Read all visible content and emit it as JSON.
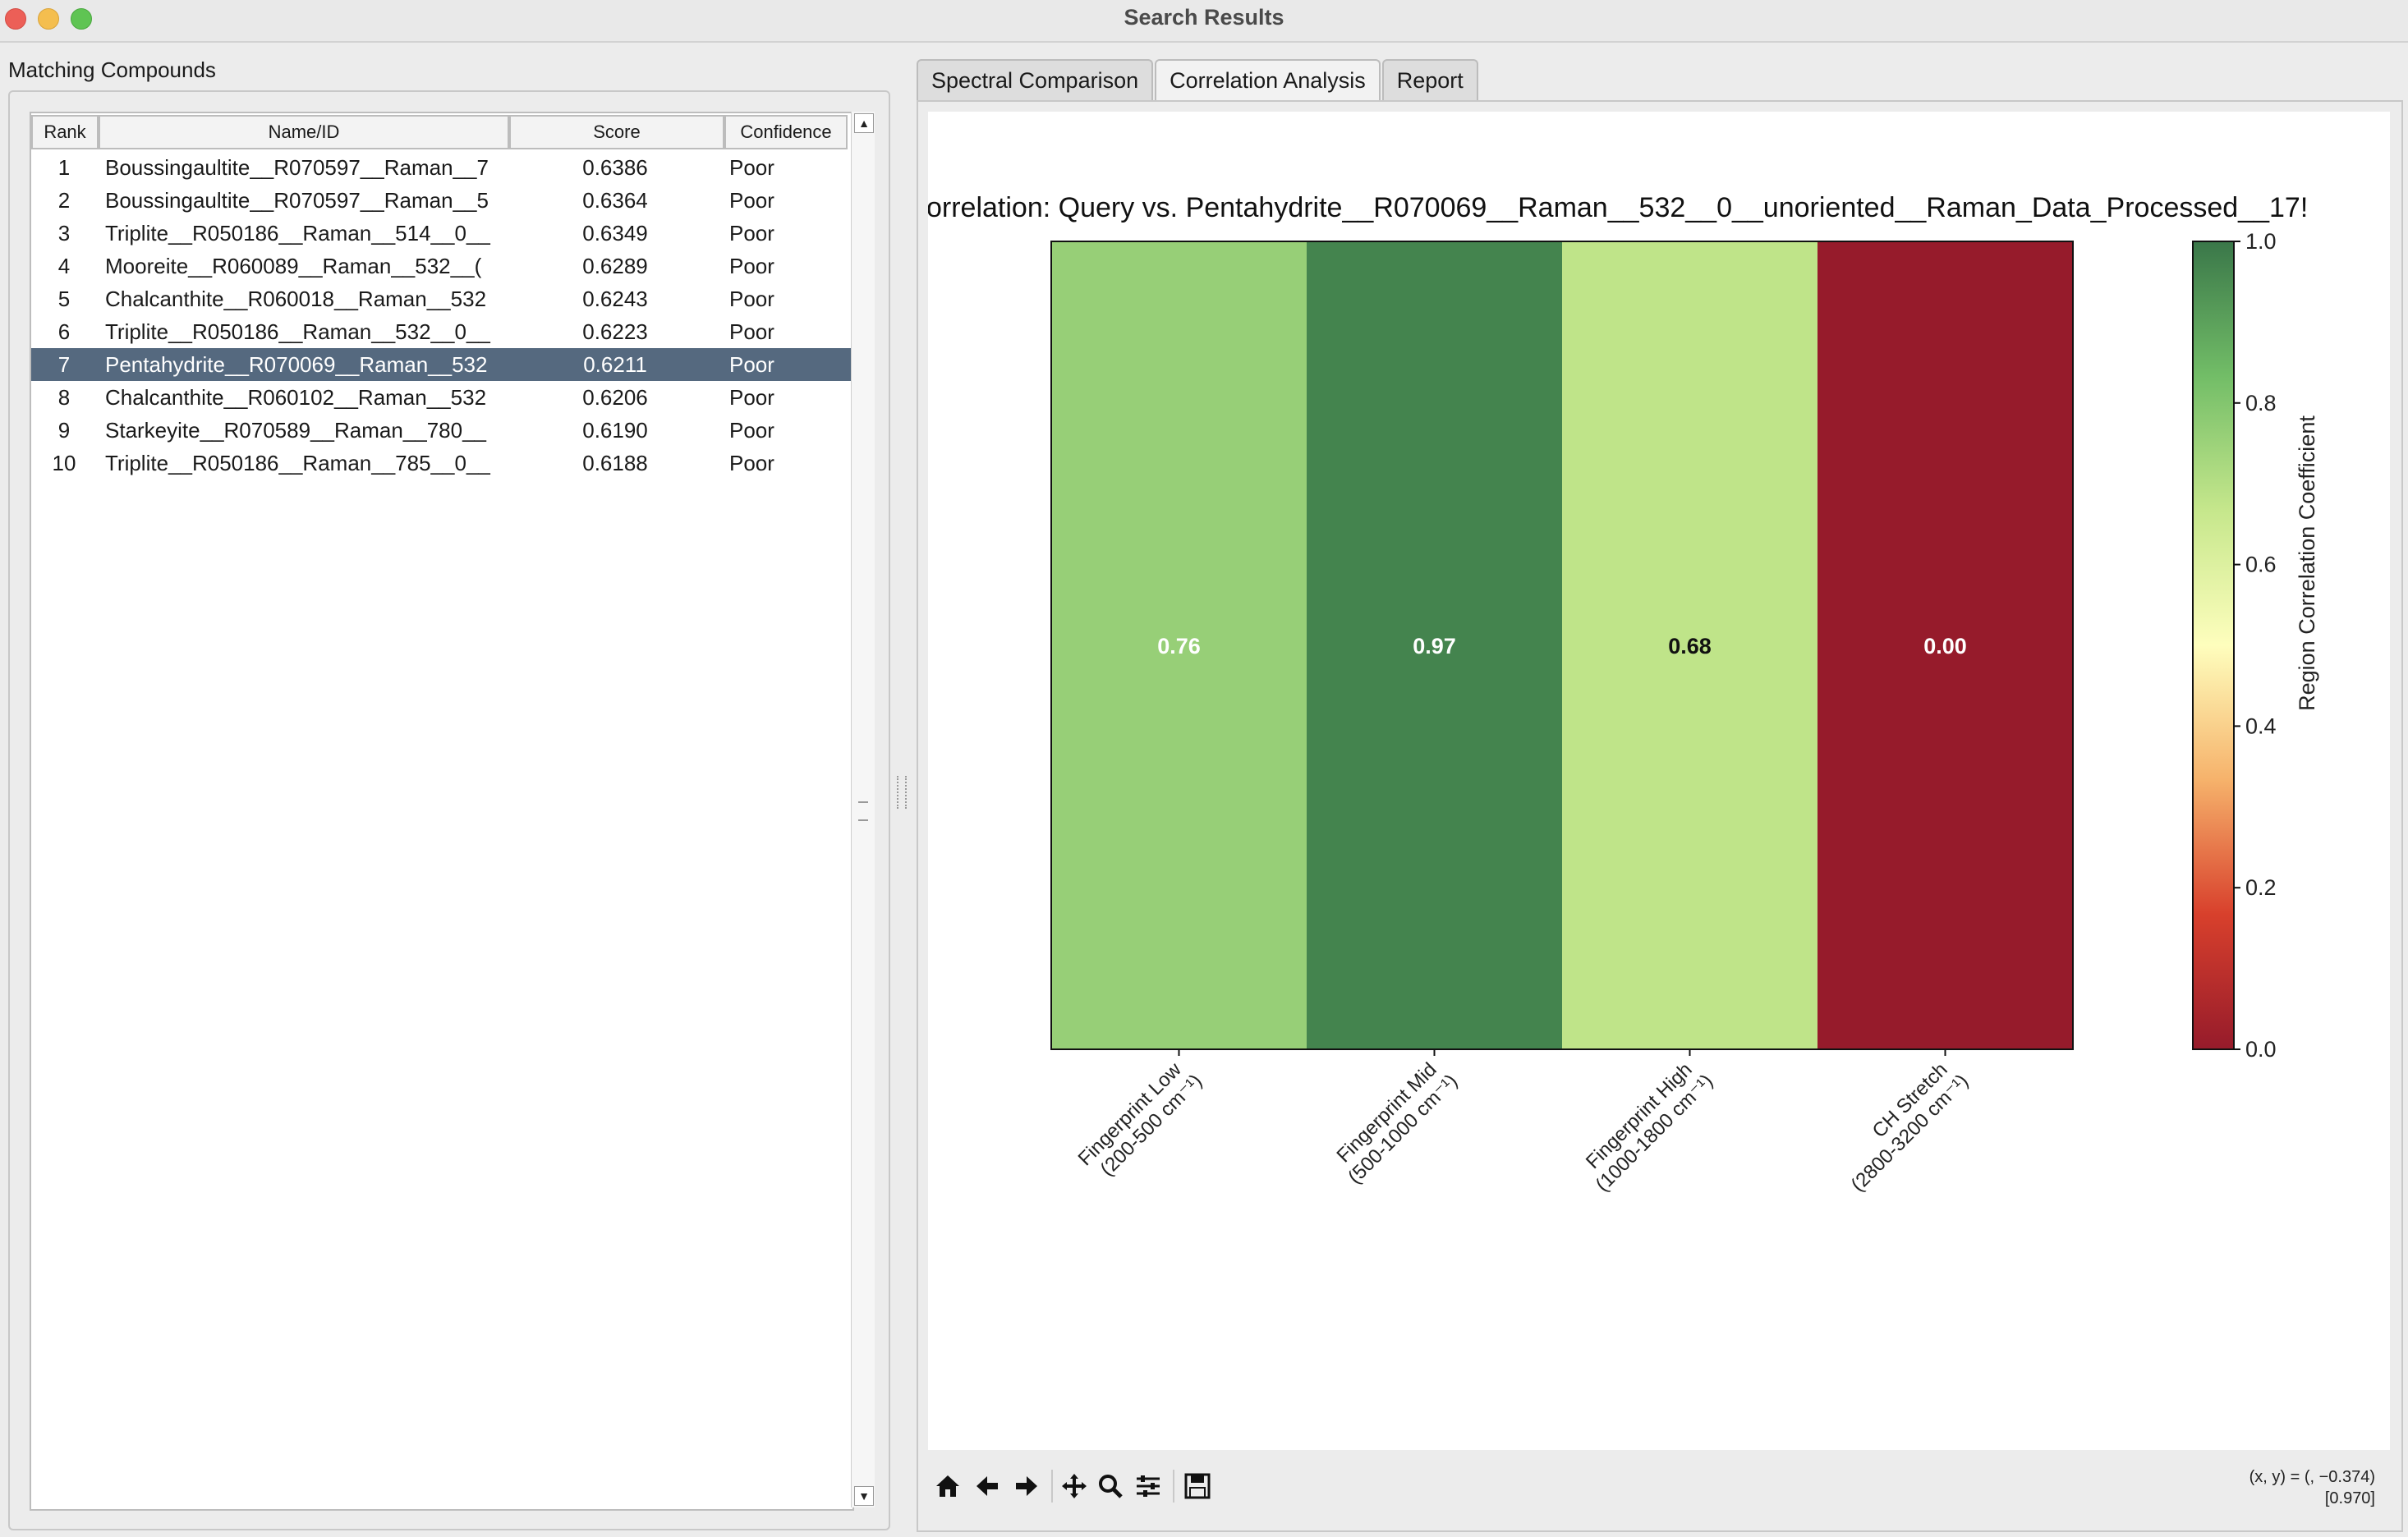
{
  "window": {
    "title": "Search Results"
  },
  "left_panel": {
    "label": "Matching Compounds",
    "columns": [
      "Rank",
      "Name/ID",
      "Score",
      "Confidence"
    ],
    "rows": [
      {
        "rank": "1",
        "name": "Boussingaultite__R070597__Raman__7",
        "score": "0.6386",
        "confidence": "Poor"
      },
      {
        "rank": "2",
        "name": "Boussingaultite__R070597__Raman__5",
        "score": "0.6364",
        "confidence": "Poor"
      },
      {
        "rank": "3",
        "name": "Triplite__R050186__Raman__514__0__",
        "score": "0.6349",
        "confidence": "Poor"
      },
      {
        "rank": "4",
        "name": "Mooreite__R060089__Raman__532__(",
        "score": "0.6289",
        "confidence": "Poor"
      },
      {
        "rank": "5",
        "name": "Chalcanthite__R060018__Raman__532",
        "score": "0.6243",
        "confidence": "Poor"
      },
      {
        "rank": "6",
        "name": "Triplite__R050186__Raman__532__0__",
        "score": "0.6223",
        "confidence": "Poor"
      },
      {
        "rank": "7",
        "name": "Pentahydrite__R070069__Raman__532",
        "score": "0.6211",
        "confidence": "Poor"
      },
      {
        "rank": "8",
        "name": "Chalcanthite__R060102__Raman__532",
        "score": "0.6206",
        "confidence": "Poor"
      },
      {
        "rank": "9",
        "name": "Starkeyite__R070589__Raman__780__",
        "score": "0.6190",
        "confidence": "Poor"
      },
      {
        "rank": "10",
        "name": "Triplite__R050186__Raman__785__0__",
        "score": "0.6188",
        "confidence": "Poor"
      }
    ],
    "selected_rank": "7"
  },
  "tabs": [
    {
      "label": "Spectral Comparison",
      "active": false
    },
    {
      "label": "Correlation Analysis",
      "active": true
    },
    {
      "label": "Report",
      "active": false
    }
  ],
  "toolbar": {
    "icons": [
      "home-icon",
      "back-arrow-icon",
      "forward-arrow-icon",
      "pan-icon",
      "zoom-icon",
      "configure-subplots-icon",
      "save-icon"
    ],
    "coords_line1": "(x, y) = (, −0.374)",
    "coords_line2": "[0.970]"
  },
  "chart_data": {
    "type": "heatmap",
    "title": "orrelation: Query vs. Pentahydrite__R070069__Raman__532__0__unoriented__Raman_Data_Processed__17!",
    "categories": [
      "Fingerprint Low\n(200-500 cm⁻¹)",
      "Fingerprint Mid\n(500-1000 cm⁻¹)",
      "Fingerprint High\n(1000-1800 cm⁻¹)",
      "CH Stretch\n(2800-3200 cm⁻¹)"
    ],
    "values": [
      0.76,
      0.97,
      0.68,
      0.0
    ],
    "value_labels": [
      "0.76",
      "0.97",
      "0.68",
      "0.00"
    ],
    "colormap": "RdYlGn",
    "colorbar": {
      "label": "Region Correlation Coefficient",
      "range": [
        0.0,
        1.0
      ],
      "ticks": [
        "0.0",
        "0.2",
        "0.4",
        "0.6",
        "0.8",
        "1.0"
      ]
    },
    "colors": {
      "stops": [
        "#961b2b",
        "#d8402c",
        "#f6b26b",
        "#fefebd",
        "#c6e78c",
        "#72bd67",
        "#3a7749"
      ]
    }
  }
}
